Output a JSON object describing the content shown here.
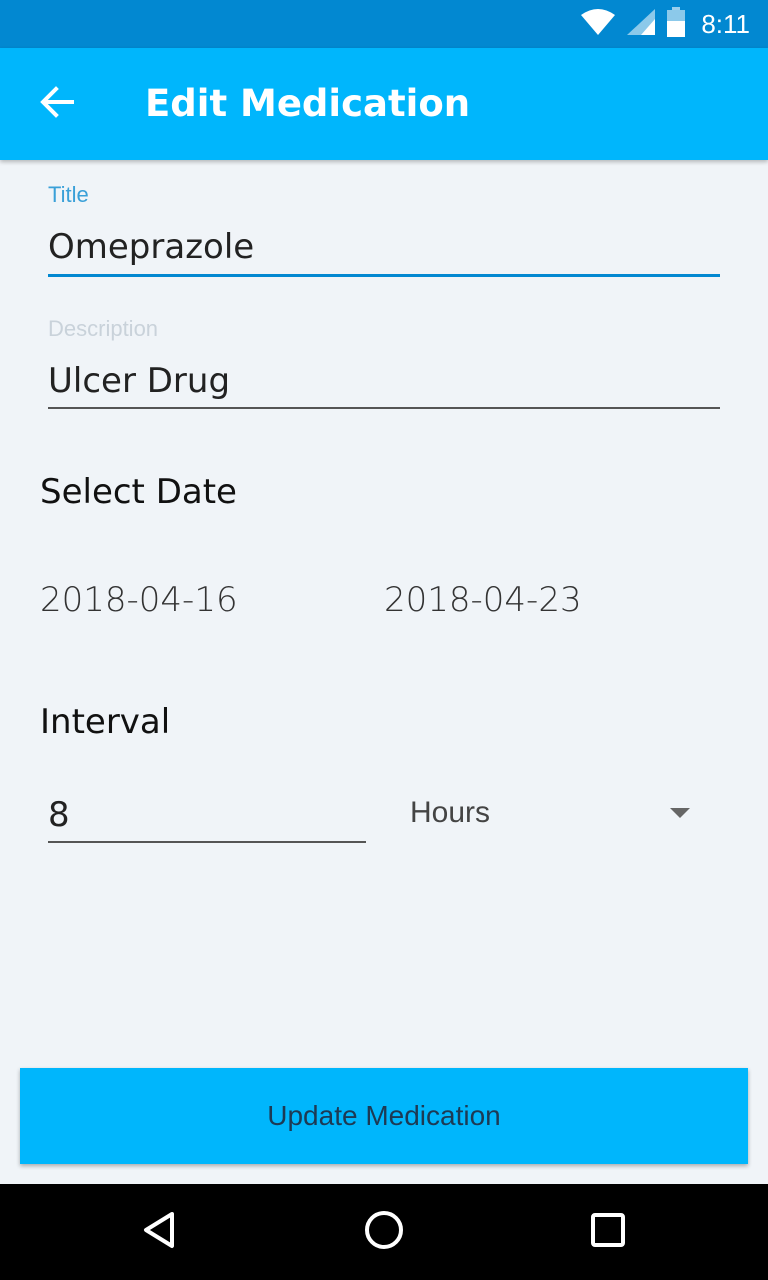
{
  "status_bar": {
    "time": "8:11",
    "icons": [
      "wifi-icon",
      "signal-icon",
      "battery-icon"
    ]
  },
  "app_bar": {
    "title": "Edit Medication",
    "back_icon": "arrow-back-icon",
    "color": "#00b6fc"
  },
  "form": {
    "title": {
      "label": "Title",
      "value": "Omeprazole"
    },
    "description": {
      "label": "Description",
      "value": "Ulcer Drug"
    },
    "select_date": {
      "heading": "Select Date",
      "start_date": "2018-04-16",
      "end_date": "2018-04-23"
    },
    "interval": {
      "heading": "Interval",
      "value": "8",
      "unit": "Hours"
    }
  },
  "update_button": {
    "label": "Update Medication"
  },
  "nav_bar": {
    "icons": [
      "back-triangle-icon",
      "home-circle-icon",
      "recents-square-icon"
    ]
  },
  "colors": {
    "accent": "#00b6fc",
    "status_bar": "#0288d1",
    "focused_underline": "#0288d1",
    "background": "#f0f4f8"
  }
}
